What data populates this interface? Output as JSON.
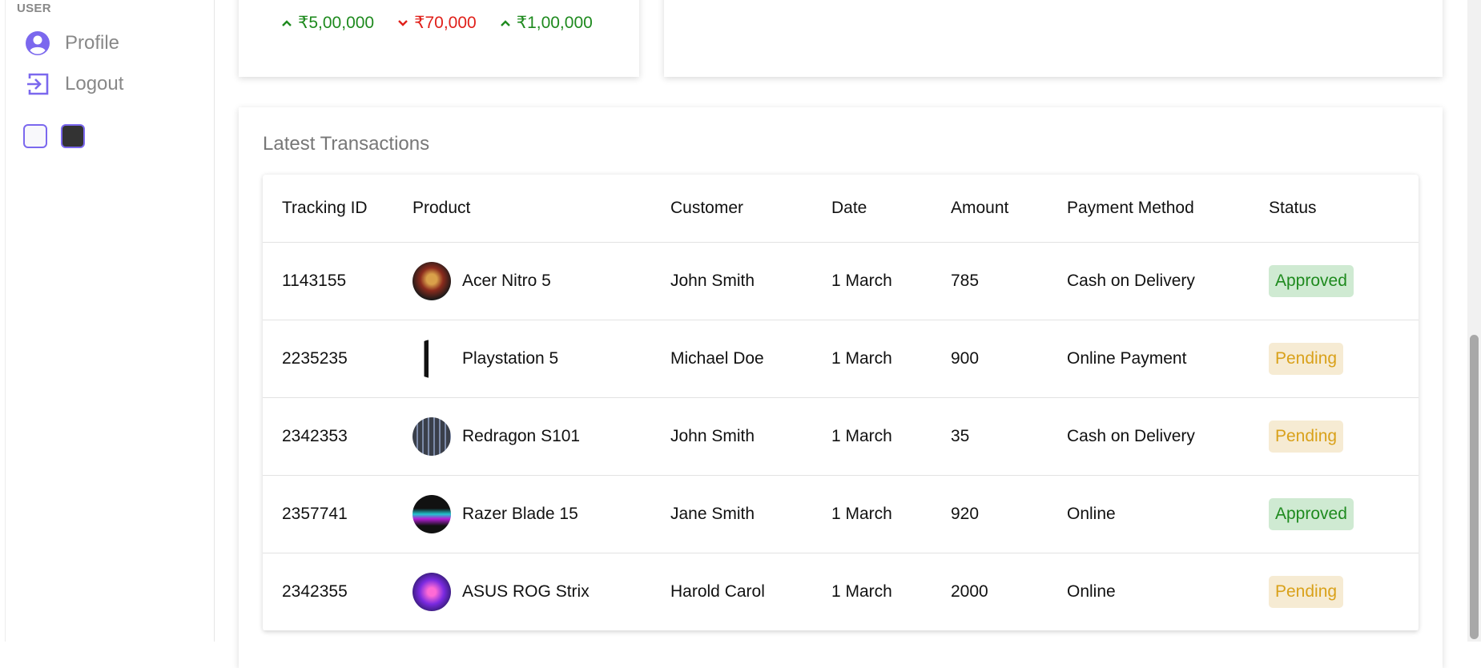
{
  "sidebar": {
    "section_title": "USER",
    "items": [
      {
        "label": "Profile",
        "icon": "profile-icon"
      },
      {
        "label": "Logout",
        "icon": "logout-icon"
      }
    ],
    "theme_options": [
      "light",
      "dark"
    ]
  },
  "stats": [
    {
      "value": "₹5,00,000",
      "direction": "up",
      "color": "#1e8a1e"
    },
    {
      "value": "₹70,000",
      "direction": "down",
      "color": "#e0201a"
    },
    {
      "value": "₹1,00,000",
      "direction": "up",
      "color": "#1e8a1e"
    }
  ],
  "transactions": {
    "title": "Latest Transactions",
    "columns": [
      "Tracking ID",
      "Product",
      "Customer",
      "Date",
      "Amount",
      "Payment Method",
      "Status"
    ],
    "rows": [
      {
        "id": "1143155",
        "product": "Acer Nitro 5",
        "customer": "John Smith",
        "date": "1 March",
        "amount": "785",
        "method": "Cash on Delivery",
        "status": "Approved"
      },
      {
        "id": "2235235",
        "product": "Playstation 5",
        "customer": "Michael Doe",
        "date": "1 March",
        "amount": "900",
        "method": "Online Payment",
        "status": "Pending"
      },
      {
        "id": "2342353",
        "product": "Redragon S101",
        "customer": "John Smith",
        "date": "1 March",
        "amount": "35",
        "method": "Cash on Delivery",
        "status": "Pending"
      },
      {
        "id": "2357741",
        "product": "Razer Blade 15",
        "customer": "Jane Smith",
        "date": "1 March",
        "amount": "920",
        "method": "Online",
        "status": "Approved"
      },
      {
        "id": "2342355",
        "product": "ASUS ROG Strix",
        "customer": "Harold Carol",
        "date": "1 March",
        "amount": "2000",
        "method": "Online",
        "status": "Pending"
      }
    ]
  },
  "colors": {
    "accent": "#7b68ee",
    "approved_bg": "#cfead2",
    "approved_text": "#1e8a1e",
    "pending_bg": "#f6ebd3",
    "pending_text": "#d9a11a"
  }
}
